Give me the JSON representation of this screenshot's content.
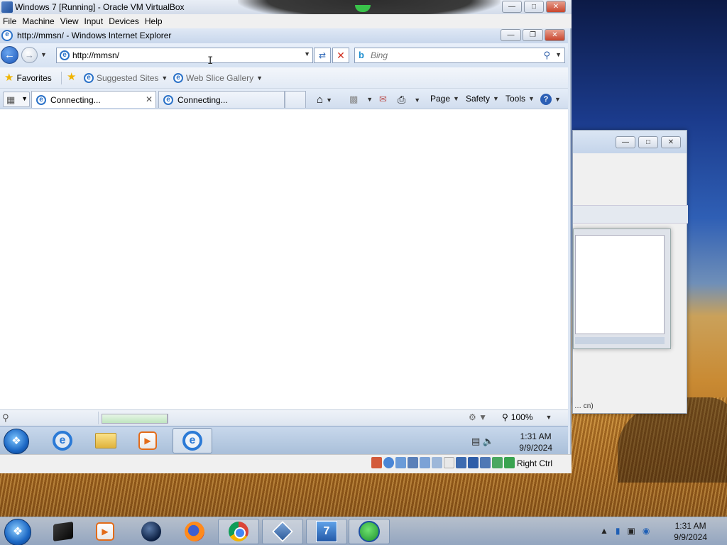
{
  "vbox": {
    "title": "Windows 7 [Running] - Oracle VM VirtualBox",
    "menu": [
      "File",
      "Machine",
      "View",
      "Input",
      "Devices",
      "Help"
    ],
    "status_host_key": "Right Ctrl"
  },
  "ie": {
    "title": "http://mmsn/ - Windows Internet Explorer",
    "address_value": "http://mmsn/",
    "search_placeholder": "Bing",
    "favorites_label": "Favorites",
    "suggested_sites_label": "Suggested Sites",
    "web_slice_label": "Web Slice Gallery",
    "tabs": [
      {
        "label": "Connecting..."
      },
      {
        "label": "Connecting..."
      }
    ],
    "commands": {
      "page": "Page",
      "safety": "Safety",
      "tools": "Tools"
    },
    "status": {
      "zoom": "100%",
      "progress": 1.0
    }
  },
  "guest_taskbar": {
    "time": "1:31 AM",
    "date": "9/9/2024"
  },
  "host_taskbar": {
    "time": "1:31 AM",
    "date": "9/9/2024"
  },
  "bg_window": {
    "fragment_text": "… cn)"
  },
  "colors": {
    "accent": "#1b56b8",
    "close_red": "#c8452c",
    "progress_green": "#bfe5bf"
  }
}
